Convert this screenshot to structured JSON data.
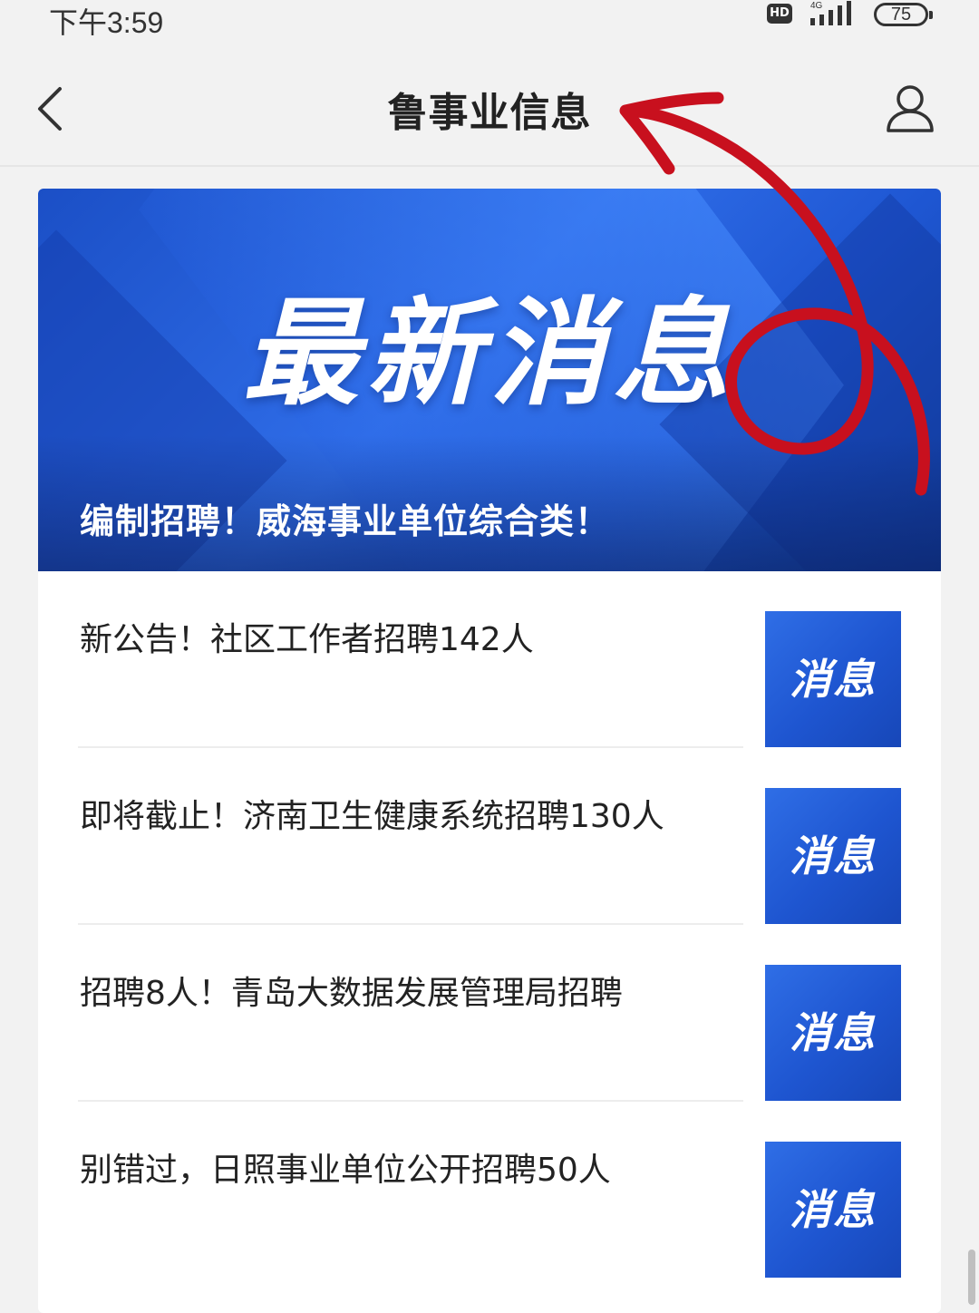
{
  "status_bar": {
    "time": "下午3:59",
    "hd_label": "HD",
    "network_label": "4G",
    "battery": "75"
  },
  "nav": {
    "title": "鲁事业信息"
  },
  "banner": {
    "heading": "最新消息",
    "caption": "编制招聘！威海事业单位综合类！"
  },
  "articles": [
    {
      "title": "新公告！社区工作者招聘142人",
      "thumb_label": "消息"
    },
    {
      "title": "即将截止！济南卫生健康系统招聘130人",
      "thumb_label": "消息"
    },
    {
      "title": "招聘8人！青岛大数据发展管理局招聘",
      "thumb_label": "消息"
    },
    {
      "title": "别错过，日照事业单位公开招聘50人",
      "thumb_label": "消息"
    }
  ],
  "colors": {
    "accent_blue": "#1e55d0",
    "annotation_red": "#c8101e"
  }
}
